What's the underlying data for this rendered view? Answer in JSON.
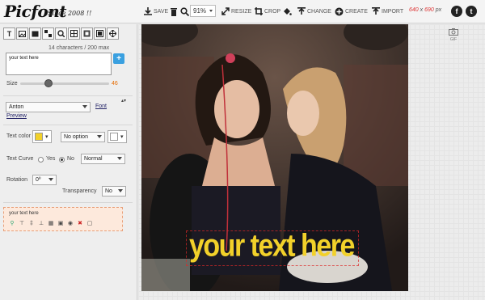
{
  "app": {
    "logo": "Picfont",
    "since": "Since 2008 !!"
  },
  "toolbar": {
    "save": "SAVE",
    "zoom": "91%",
    "resize": "RESIZE",
    "crop": "CROP",
    "change": "CHANGE",
    "create": "CREATE",
    "import": "IMPORT",
    "dims_w": "640",
    "dims_x": "x",
    "dims_h": "690",
    "dims_unit": "px"
  },
  "panel": {
    "char_count": "14 characters / 200 max",
    "text_value": "your text here",
    "size_label": "Size",
    "size_value": "46",
    "size_fraction": 0.32,
    "font_value": "Anton",
    "font_link": "Font",
    "preview_link": "Preview",
    "text_color_label": "Text color",
    "text_color": "#f2d12a",
    "shadow_option": "No option",
    "curve_label": "Text Curve",
    "curve_yes": "Yes",
    "curve_no": "No",
    "curve_style": "Normal",
    "rotation_label": "Rotation",
    "rotation_value": "0º",
    "transparency_label": "Transparency",
    "transparency_value": "No",
    "layer_text": "your text here"
  },
  "canvas": {
    "gif_label": "GIF",
    "overlay_text": "your text here"
  }
}
